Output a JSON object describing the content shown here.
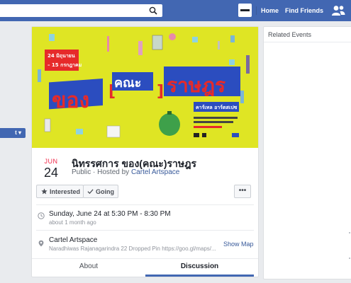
{
  "topbar": {
    "nav": [
      {
        "label": "Home"
      },
      {
        "label": "Find Friends"
      }
    ],
    "color": "#4267b2"
  },
  "left_button": {
    "label": "t ▾"
  },
  "banner": {
    "date_line1": "24 มิถุนายน",
    "date_line2": "– 15 กรกฎาคม",
    "title_a": "ของ",
    "title_b": "คณะ",
    "title_c": "ราษฎร",
    "place": "คาร์เทล อาร์ตสเปซ",
    "bg": "#dfe524",
    "accent_red": "#e62a2a",
    "accent_blue": "#2b4dbf"
  },
  "event": {
    "month": "JUN",
    "day": "24",
    "title": "นิทรรศการ ของ(คณะ)ราษฎร",
    "privacy": "Public",
    "hosted_by": "Hosted by",
    "host": "Cartel Artspace",
    "buttons": {
      "interested": "Interested",
      "going": "Going",
      "more": "•••"
    },
    "time": "Sunday, June 24 at 5:30 PM - 8:30 PM",
    "time_ago": "about 1 month ago",
    "place": "Cartel Artspace",
    "address": "Naradhiwas Rajanagarindra 22 Dropped Pin https://goo.gl/maps/...",
    "show_map": "Show Map",
    "tabs": [
      {
        "label": "About"
      },
      {
        "label": "Discussion"
      }
    ]
  },
  "related": {
    "title": "Related Events"
  }
}
